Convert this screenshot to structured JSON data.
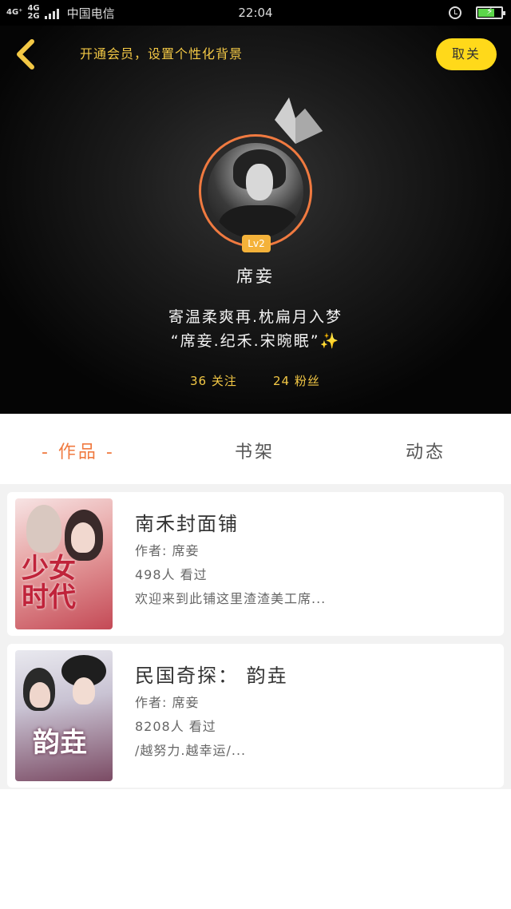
{
  "status_bar": {
    "network_1": "4G⁺",
    "network_2": "4G\n2G",
    "carrier": "中国电信",
    "time": "22:04",
    "battery_level": 0.7,
    "battery_color": "#5cd64a"
  },
  "header": {
    "promo_text": "开通会员，设置个性化背景",
    "unfollow_label": "取关",
    "level": "Lv2",
    "name": "席妾",
    "bio_line_1": "寄温柔爽再.枕扁月入梦",
    "bio_line_2": "“席妾.纪禾.宋晼眠”",
    "bio_sparkle": "✨",
    "follow_count_text": "36 关注",
    "fans_count_text": "24 粉丝",
    "accent_color": "#f3c845",
    "ring_color": "#f07a40"
  },
  "tabs": [
    {
      "label": "- 作品 -",
      "active": true
    },
    {
      "label": "书架",
      "active": false
    },
    {
      "label": "动态",
      "active": false
    }
  ],
  "works": [
    {
      "title": "南禾封面铺",
      "author": "作者: 席妾",
      "views": "498人 看过",
      "description": "欢迎来到此铺这里渣渣美工席...",
      "cover_text": "少女\n时代"
    },
    {
      "title": "民国奇探： 韵垚",
      "author": "作者: 席妾",
      "views": "8208人 看过",
      "description": "/越努力.越幸运/...",
      "cover_text": "韵垚"
    }
  ]
}
